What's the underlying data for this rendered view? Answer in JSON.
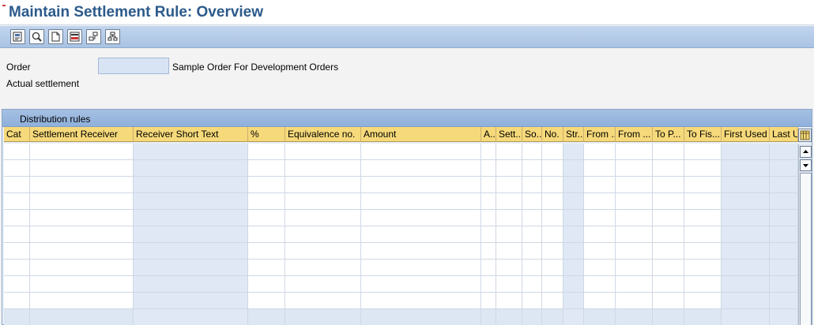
{
  "title": "Maintain Settlement Rule: Overview",
  "toolbar": {
    "buttons": [
      {
        "name": "hierarchy-icon"
      },
      {
        "name": "display-icon"
      },
      {
        "name": "new-document-icon"
      },
      {
        "name": "list-icon"
      },
      {
        "name": "settlement-icon"
      },
      {
        "name": "structure-icon"
      }
    ]
  },
  "header": {
    "order_label": "Order",
    "order_value": "",
    "order_description": "Sample Order For Development Orders",
    "actual_settlement_label": "Actual settlement"
  },
  "grid": {
    "title": "Distribution rules",
    "columns": [
      "Cat",
      "Settlement Receiver",
      "Receiver Short Text",
      "%",
      "Equivalence no.",
      "Amount",
      "A...",
      "Sett...",
      "So...",
      "No.",
      "Str...",
      "From ...",
      "From ...",
      "To P...",
      "To Fis...",
      "First Used",
      "Last U..."
    ]
  }
}
